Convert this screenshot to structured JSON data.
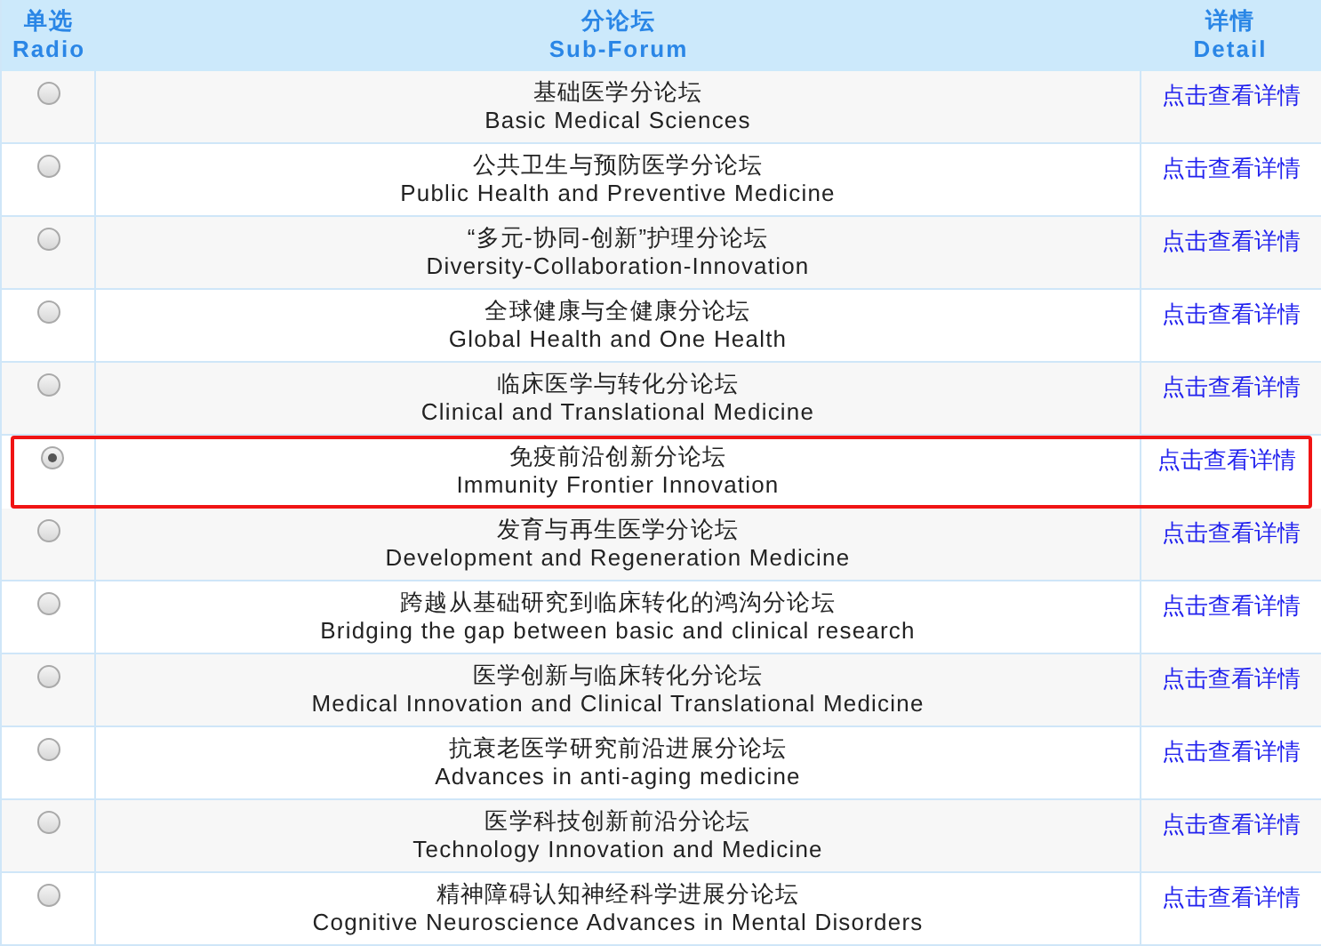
{
  "header": {
    "radio_zh": "单选",
    "radio_en": "Radio",
    "forum_zh": "分论坛",
    "forum_en": "Sub-Forum",
    "detail_zh": "详情",
    "detail_en": "Detail"
  },
  "rows": [
    {
      "zh": "基础医学分论坛",
      "en": "Basic Medical Sciences",
      "link": "点击查看详情",
      "selected": false
    },
    {
      "zh": "公共卫生与预防医学分论坛",
      "en": "Public Health and Preventive Medicine",
      "link": "点击查看详情",
      "selected": false
    },
    {
      "zh": "“多元-协同-创新”护理分论坛",
      "en": "Diversity-Collaboration-Innovation",
      "link": "点击查看详情",
      "selected": false
    },
    {
      "zh": "全球健康与全健康分论坛",
      "en": "Global Health and One Health",
      "link": "点击查看详情",
      "selected": false
    },
    {
      "zh": "临床医学与转化分论坛",
      "en": "Clinical and Translational Medicine",
      "link": "点击查看详情",
      "selected": false
    },
    {
      "zh": "免疫前沿创新分论坛",
      "en": "Immunity Frontier Innovation",
      "link": "点击查看详情",
      "selected": true
    },
    {
      "zh": "发育与再生医学分论坛",
      "en": "Development and Regeneration Medicine",
      "link": "点击查看详情",
      "selected": false
    },
    {
      "zh": "跨越从基础研究到临床转化的鸿沟分论坛",
      "en": "Bridging the gap between basic and clinical research",
      "link": "点击查看详情",
      "selected": false
    },
    {
      "zh": "医学创新与临床转化分论坛",
      "en": "Medical Innovation and Clinical Translational Medicine",
      "link": "点击查看详情",
      "selected": false
    },
    {
      "zh": "抗衰老医学研究前沿进展分论坛",
      "en": "Advances in anti-aging medicine",
      "link": "点击查看详情",
      "selected": false
    },
    {
      "zh": "医学科技创新前沿分论坛",
      "en": "Technology Innovation and Medicine",
      "link": "点击查看详情",
      "selected": false
    },
    {
      "zh": "精神障碍认知神经科学进展分论坛",
      "en": "Cognitive Neuroscience Advances in Mental Disorders",
      "link": "点击查看详情",
      "selected": false
    }
  ]
}
